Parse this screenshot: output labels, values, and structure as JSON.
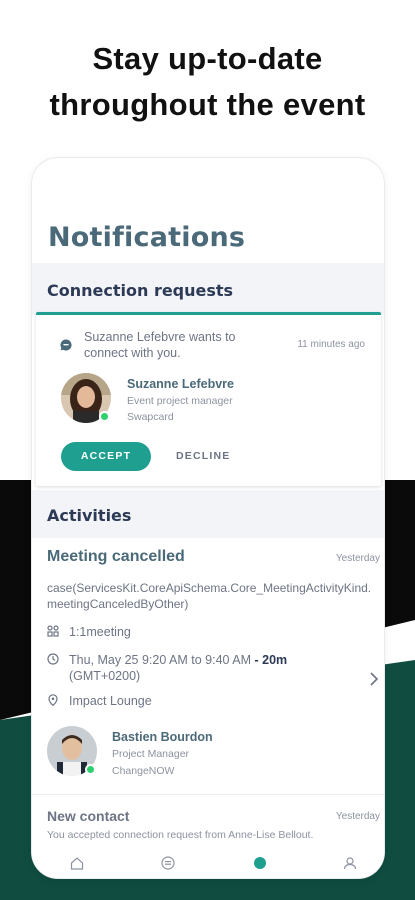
{
  "headline": {
    "line1": "Stay up-to-date",
    "line2": "throughout the event"
  },
  "page_title": "Notifications",
  "connection_requests": {
    "section_label": "Connection requests",
    "request": {
      "message": "Suzanne Lefebvre wants to connect with you.",
      "time": "11 minutes ago",
      "name": "Suzanne Lefebvre",
      "job_title": "Event project manager",
      "company": "Swapcard",
      "accept_label": "ACCEPT",
      "decline_label": "DECLINE"
    }
  },
  "activities": {
    "section_label": "Activities",
    "meeting": {
      "title": "Meeting cancelled",
      "time": "Yesterday",
      "case_text": "case(ServicesKit.CoreApiSchema.Core_MeetingActivityKind.meetingCanceledByOther)",
      "type": "1:1meeting",
      "datetime_main": "Thu, May 25 9:20 AM to 9:40 AM",
      "datetime_sep": " - ",
      "duration": "20m",
      "timezone": "(GMT+0200)",
      "location": "Impact Lounge",
      "person_name": "Bastien Bourdon",
      "person_title": "Project Manager",
      "person_company": "ChangeNOW"
    },
    "new_contact": {
      "title": "New contact",
      "time": "Yesterday",
      "text": "You accepted connection request from Anne-Lise Bellout."
    }
  },
  "tabs": [
    "home-icon",
    "chat-icon",
    "notifications-icon",
    "profile-icon"
  ],
  "colors": {
    "accent": "#1f9f90",
    "title": "#4b6a79",
    "online": "#2ed06e",
    "bg_dark": "#0a0a0a",
    "bg_green": "#104c40"
  }
}
